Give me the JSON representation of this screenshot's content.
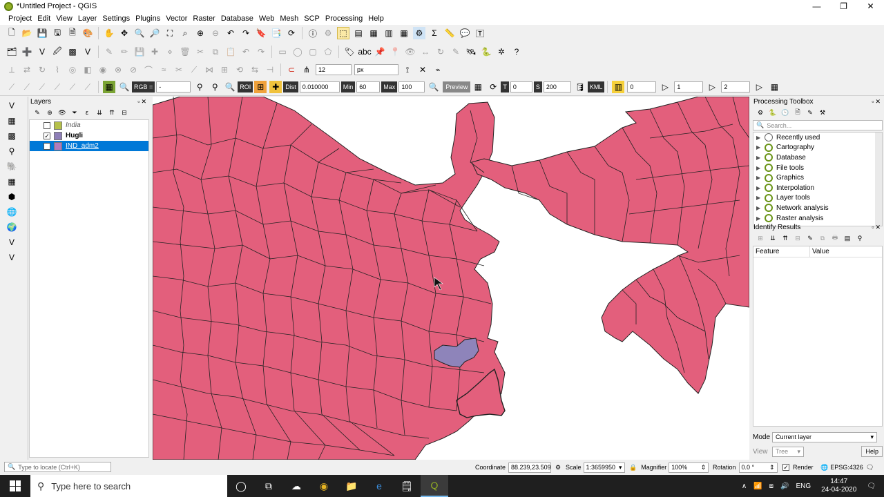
{
  "window": {
    "title": "*Untitled Project - QGIS",
    "controls": [
      "—",
      "❐",
      "✕"
    ]
  },
  "menu": [
    "Project",
    "Edit",
    "View",
    "Layer",
    "Settings",
    "Plugins",
    "Vector",
    "Raster",
    "Database",
    "Web",
    "Mesh",
    "SCP",
    "Processing",
    "Help"
  ],
  "scp_toolbar": {
    "snap_value": "12",
    "snap_unit": "px",
    "rgb_label": "RGB =",
    "rgb_value": "-",
    "roi_label": "ROI",
    "dist_label": "Dist",
    "dist_value": "0.010000",
    "min_label": "Min",
    "min_value": "60",
    "max_label": "Max",
    "max_value": "100",
    "preview_label": "Preview",
    "t_label": "T",
    "t_value": "0",
    "s_label": "S",
    "s_value": "200",
    "kml_label": "KML",
    "band_1": "0",
    "band_2": "1",
    "band_3": "2"
  },
  "layers_panel": {
    "title": "Layers",
    "layers": [
      {
        "name": "India",
        "checked": false,
        "color": "#b5c04a",
        "style": "italic"
      },
      {
        "name": "Hugli",
        "checked": true,
        "color": "#8e7fb8",
        "style": "bold"
      },
      {
        "name": "IND_adm2",
        "checked": true,
        "color": "#b07bbd",
        "style": "selected"
      }
    ]
  },
  "map": {
    "fill_color": "#e35f7c",
    "highlight_color": "#8e84ba",
    "stroke_color": "#222222"
  },
  "processing_toolbox": {
    "title": "Processing Toolbox",
    "search_placeholder": "Search...",
    "items": [
      "Recently used",
      "Cartography",
      "Database",
      "File tools",
      "Graphics",
      "Interpolation",
      "Layer tools",
      "Network analysis",
      "Raster analysis"
    ]
  },
  "identify_results": {
    "title": "Identify Results",
    "columns": [
      "Feature",
      "Value"
    ],
    "mode_label": "Mode",
    "mode_value": "Current layer",
    "view_label": "View",
    "view_value": "Tree",
    "help_label": "Help"
  },
  "statusbar": {
    "locator_placeholder": "Type to locate (Ctrl+K)",
    "coordinate_label": "Coordinate",
    "coordinate_value": "88.239,23.509",
    "scale_label": "Scale",
    "scale_value": "1:3659950",
    "magnifier_label": "Magnifier",
    "magnifier_value": "100%",
    "rotation_label": "Rotation",
    "rotation_value": "0.0 °",
    "render_label": "Render",
    "crs": "EPSG:4326"
  },
  "taskbar": {
    "search_placeholder": "Type here to search",
    "language": "ENG",
    "time": "14:47",
    "date": "24-04-2020"
  }
}
